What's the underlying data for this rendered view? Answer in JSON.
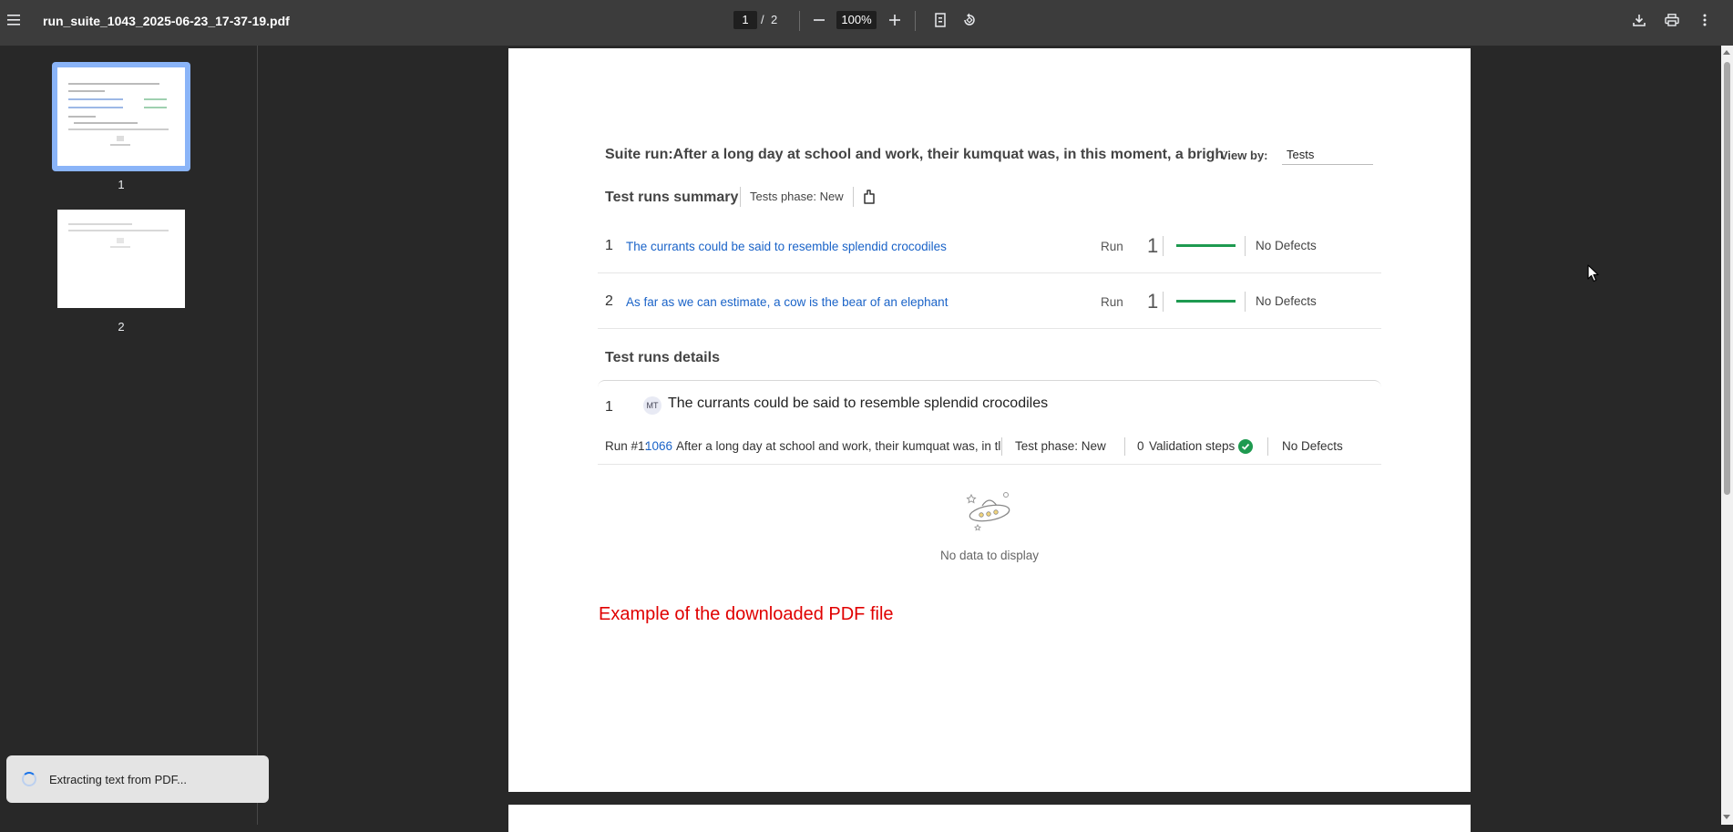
{
  "toolbar": {
    "filename": "run_suite_1043_2025-06-23_17-37-19.pdf",
    "current_page": "1",
    "page_separator": "/",
    "total_pages": "2",
    "zoom": "100%"
  },
  "sidebar": {
    "thumbnails": [
      {
        "label": "1",
        "selected": true
      },
      {
        "label": "2",
        "selected": false
      }
    ],
    "toast": "Extracting text from PDF..."
  },
  "document": {
    "suite_title": "Suite run:After a long day at school and work, their kumquat was, in this moment, a bright fig",
    "view_by_label": "View by:",
    "view_by_value": "Tests",
    "summary_title": "Test runs summary",
    "tests_phase": "Tests phase: New",
    "summary_rows": [
      {
        "num": "1",
        "name": "The currants could be said to resemble splendid crocodiles",
        "run_label": "Run",
        "run_count": "1",
        "defects": "No Defects"
      },
      {
        "num": "2",
        "name": "As far as we can estimate, a cow is the bear of an elephant",
        "run_label": "Run",
        "run_count": "1",
        "defects": "No Defects"
      }
    ],
    "details_title": "Test runs details",
    "detail": {
      "num": "1",
      "badge": "MT",
      "name": "The currants could be said to resemble splendid crocodiles",
      "run_prefix": "Run #1:",
      "run_id": "1066",
      "run_description": "After a long day at school and work, their kumquat was, in tl",
      "test_phase": "Test phase: New",
      "validation_count": "0",
      "validation_label": "Validation steps",
      "defects": "No Defects"
    },
    "no_data": "No data to display",
    "example_note": "Example of the downloaded PDF file"
  },
  "colors": {
    "toolbar_bg": "#3c3c3c",
    "viewer_bg": "#282828",
    "link": "#1a63c8",
    "success": "#1e9a50",
    "note_red": "#e00000",
    "thumb_selected": "#8ab4f8"
  }
}
